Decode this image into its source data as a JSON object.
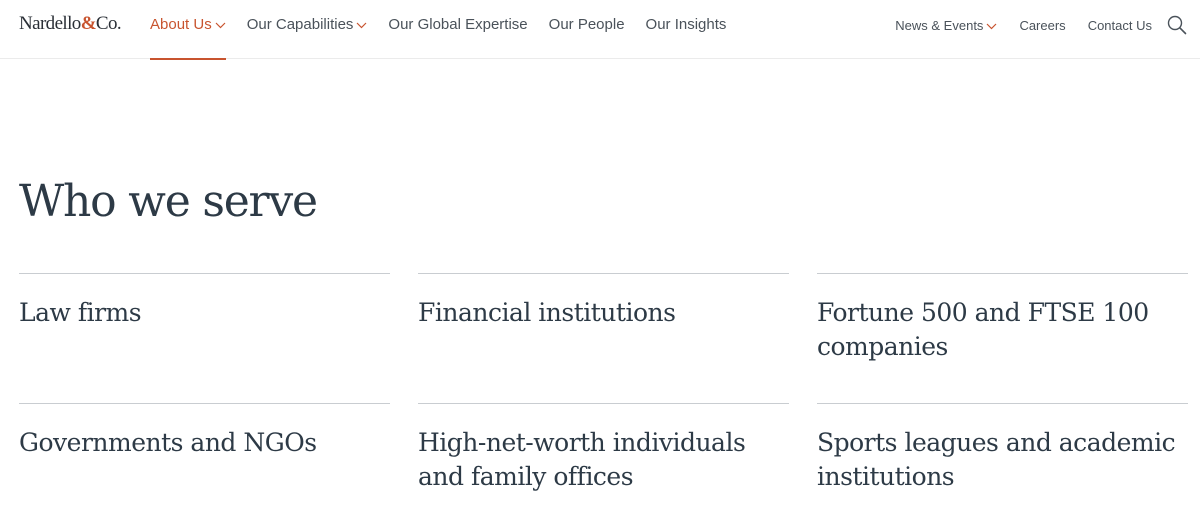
{
  "brand": {
    "logo_left": "Nardello",
    "logo_amp": "&",
    "logo_right": "Co.",
    "accent_color": "#c8542f"
  },
  "nav": {
    "primary": [
      {
        "label": "About Us",
        "has_dropdown": true,
        "active": true
      },
      {
        "label": "Our Capabilities",
        "has_dropdown": true,
        "active": false
      },
      {
        "label": "Our Global Expertise",
        "has_dropdown": false,
        "active": false
      },
      {
        "label": "Our People",
        "has_dropdown": false,
        "active": false
      },
      {
        "label": "Our Insights",
        "has_dropdown": false,
        "active": false
      }
    ],
    "secondary": [
      {
        "label": "News & Events",
        "has_dropdown": true
      },
      {
        "label": "Careers",
        "has_dropdown": false
      },
      {
        "label": "Contact Us",
        "has_dropdown": false
      }
    ],
    "search_icon": "search-icon"
  },
  "main": {
    "title": "Who we serve",
    "categories": [
      {
        "label": "Law firms"
      },
      {
        "label": "Financial institutions"
      },
      {
        "label": "Fortune 500 and FTSE 100 companies"
      },
      {
        "label": "Governments and NGOs"
      },
      {
        "label": "High-net-worth individuals and family offices"
      },
      {
        "label": "Sports leagues and academic institutions"
      }
    ]
  }
}
